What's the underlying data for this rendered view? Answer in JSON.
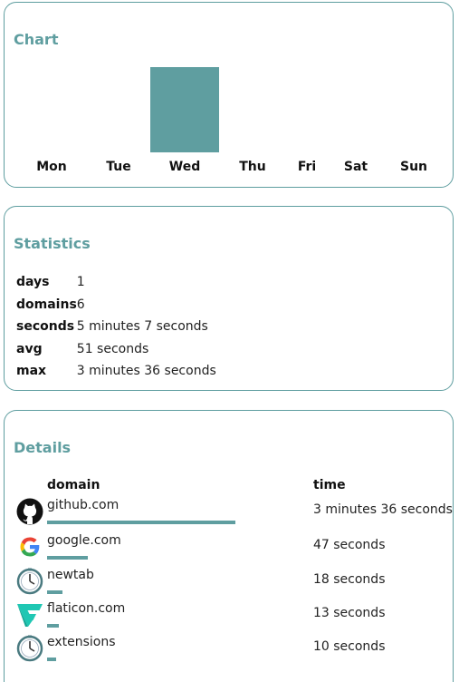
{
  "chart": {
    "title": "Chart",
    "accent_color": "#5f9ea0",
    "chart_data": {
      "type": "bar",
      "categories": [
        "Mon",
        "Tue",
        "Wed",
        "Thu",
        "Fri",
        "Sat",
        "Sun"
      ],
      "values": [
        0,
        0,
        307,
        0,
        0,
        0,
        0
      ],
      "title": "",
      "xlabel": "",
      "ylabel": "",
      "ylim": [
        0,
        307
      ]
    }
  },
  "statistics": {
    "title": "Statistics",
    "rows": [
      {
        "key": "days",
        "value": "1"
      },
      {
        "key": "domains",
        "value": "6"
      },
      {
        "key": "seconds",
        "value": "5 minutes 7 seconds"
      },
      {
        "key": "avg",
        "value": "51 seconds"
      },
      {
        "key": "max",
        "value": "3 minutes 36 seconds"
      }
    ]
  },
  "details": {
    "title": "Details",
    "col_domain": "domain",
    "col_time": "time",
    "rows": [
      {
        "domain": "github.com",
        "time": "3 minutes 36 seconds",
        "fraction": 1.0,
        "icon": "github-icon"
      },
      {
        "domain": "google.com",
        "time": "47 seconds",
        "fraction": 0.2176,
        "icon": "google-icon"
      },
      {
        "domain": "newtab",
        "time": "18 seconds",
        "fraction": 0.0833,
        "icon": "clock-icon"
      },
      {
        "domain": "flaticon.com",
        "time": "13 seconds",
        "fraction": 0.0602,
        "icon": "flaticon-icon"
      },
      {
        "domain": "extensions",
        "time": "10 seconds",
        "fraction": 0.0463,
        "icon": "clock-icon"
      }
    ]
  }
}
